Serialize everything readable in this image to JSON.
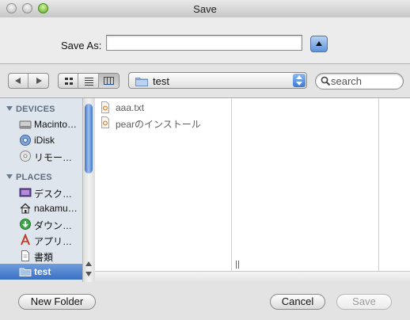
{
  "window": {
    "title": "Save"
  },
  "save_as": {
    "label": "Save As:",
    "value": ""
  },
  "toolbar": {
    "location": "test",
    "search_placeholder": "search"
  },
  "sidebar": {
    "devices_header": "DEVICES",
    "places_header": "PLACES",
    "devices": [
      {
        "label": "Macinto…",
        "icon": "hard-drive-icon"
      },
      {
        "label": "iDisk",
        "icon": "idisk-icon"
      },
      {
        "label": "リモート…",
        "icon": "remote-disc-icon"
      }
    ],
    "places": [
      {
        "label": "デスクト…",
        "icon": "desktop-folder-icon"
      },
      {
        "label": "nakamu…",
        "icon": "home-icon"
      },
      {
        "label": "ダウンロ…",
        "icon": "downloads-icon"
      },
      {
        "label": "アプリケ…",
        "icon": "applications-icon"
      },
      {
        "label": "書類",
        "icon": "documents-icon"
      },
      {
        "label": "test",
        "icon": "folder-icon",
        "selected": true
      }
    ]
  },
  "files": [
    {
      "name": "aaa.txt"
    },
    {
      "name": "pearのインストール"
    }
  ],
  "buttons": {
    "new_folder": "New Folder",
    "cancel": "Cancel",
    "save": "Save"
  },
  "colors": {
    "selection": "#3a6fc4",
    "sidebar_bg": "#dfe5ed",
    "accent": "#5f93db"
  }
}
